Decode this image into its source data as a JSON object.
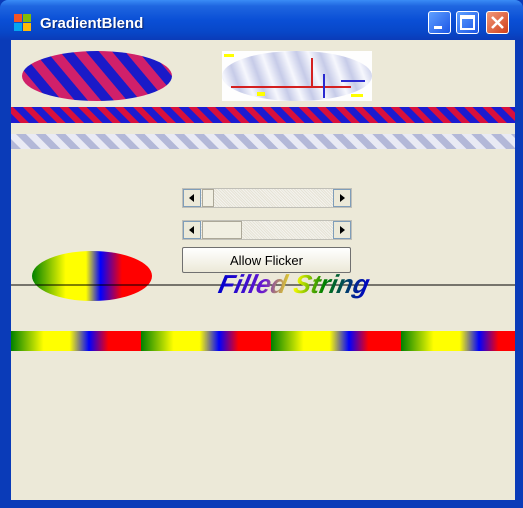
{
  "window": {
    "title": "GradientBlend"
  },
  "controls": {
    "flicker_button_label": "Allow Flicker",
    "scrollbar1_value_pct": 12,
    "scrollbar2_value_pct": 30
  },
  "canvas": {
    "filled_string": "Filled String"
  },
  "colors": {
    "red": "#ff0000",
    "blue": "#0000ff",
    "yellow": "#ffff00",
    "green": "#008000",
    "form_bg": "#ece9d8"
  }
}
